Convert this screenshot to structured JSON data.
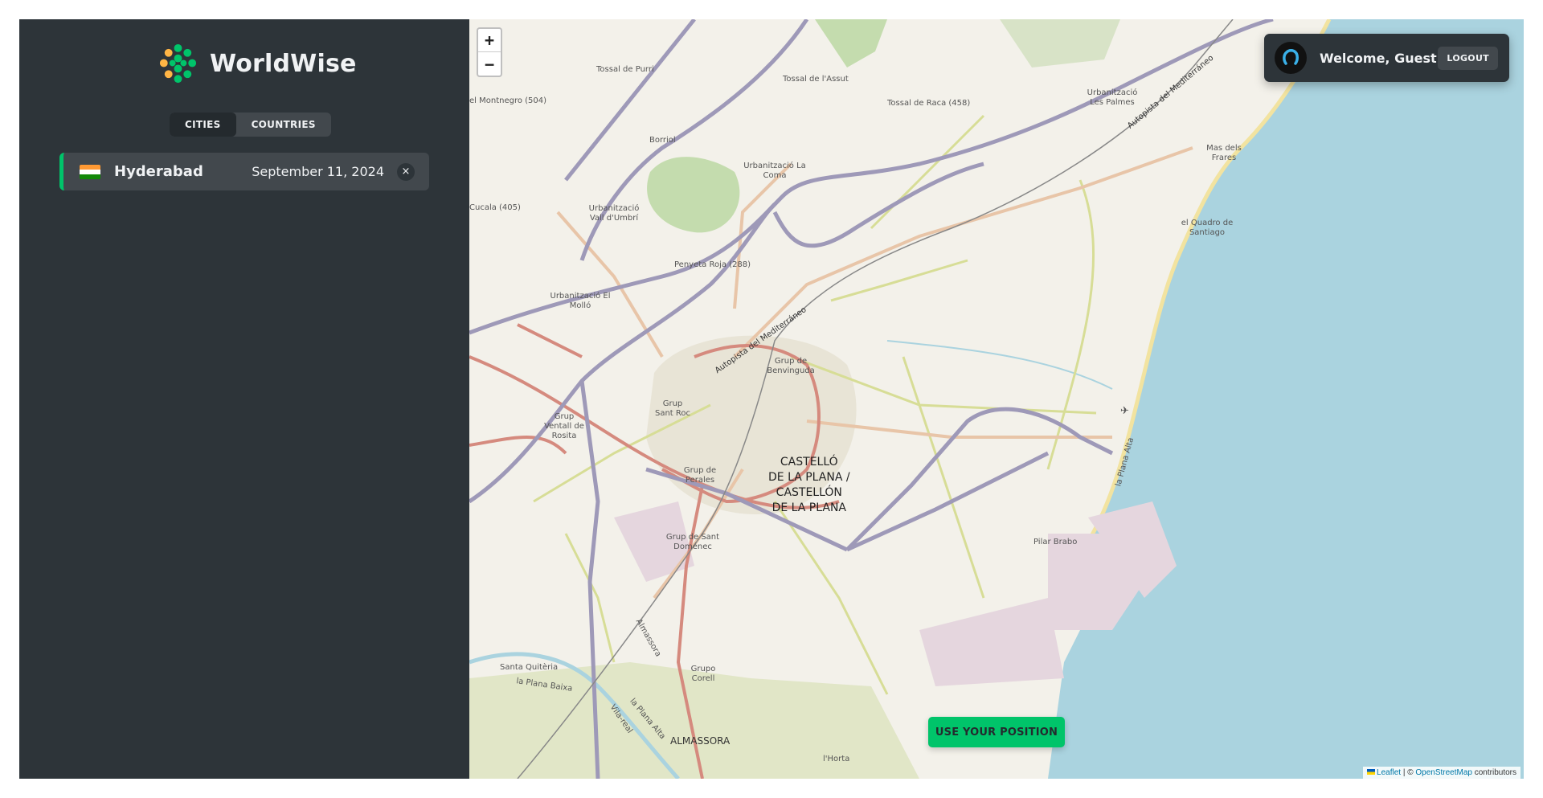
{
  "app": {
    "name": "WorldWise"
  },
  "tabs": [
    {
      "label": "CITIES",
      "active": true
    },
    {
      "label": "COUNTRIES",
      "active": false
    }
  ],
  "cities": [
    {
      "name": "Hyderabad",
      "date": "September 11, 2024",
      "flag": "india-flag",
      "delete_label": "×"
    }
  ],
  "map": {
    "zoom_in": "+",
    "zoom_out": "−",
    "main_city_label": [
      "CASTELLÓ",
      "DE LA PLANA /",
      "CASTELLÓN",
      "DE LA PLANA"
    ],
    "place_labels": {
      "tossal_purri": "Tossal de Purri",
      "tossal_assut": "Tossal de l'Assut",
      "tossal_raca": "Tossal de Raca (458)",
      "montnegro": "el Montnegro (504)",
      "borriol": "Borriol",
      "urb_coma": "Urbanització La Coma",
      "urb_palmes": "Urbanització Les Palmes",
      "mas_frares": "Mas dels Frares",
      "quadro": "el Quadro de Santiago",
      "cucala": "Cucala (405)",
      "urb_umbri": "Urbanització Vall d'Umbrí",
      "penyeta": "Penyeta Roja (288)",
      "urb_mollo": "Urbanització El Molló",
      "grup_benvinguda": "Grup de Benvinguda",
      "grup_roc": "Grup Sant Roc",
      "grup_rosita": "Grup Ventall de Rosita",
      "grup_perales": "Grup de Perales",
      "grup_domenec": "Grup de Sant Doménec",
      "pilar_brabo": "Pilar Brabo",
      "almassora_road": "Almassora",
      "grup_corell": "Grupo Corell",
      "santa_quiteria": "Santa Quitèria",
      "plana_baixa": "la Plana Baixa",
      "via_real": "Vila-real",
      "plana_alta": "la Plana Alta",
      "almassora": "ALMASSORA",
      "horta": "l'Horta",
      "autopista_1": "Autopista del Mediterráneo",
      "autopista_2": "Autopista del Mediterráneo",
      "plana_alta_coast": "la Plana Alta"
    },
    "colors": {
      "water": "#aad3df",
      "motorway": "#9e99b8",
      "trunk": "#d58a7e",
      "secondary": "#e8c5a8",
      "tertiary": "#d7dd96"
    }
  },
  "user": {
    "welcome": "Welcome, Guest",
    "logout_label": "LOGOUT",
    "avatar": "user-avatar"
  },
  "position_button": "USE YOUR POSITION",
  "attribution": {
    "leaflet": "Leaflet",
    "separator": " | © ",
    "osm": "OpenStreetMap",
    "suffix": " contributors"
  },
  "brand_color": "#00c46a"
}
